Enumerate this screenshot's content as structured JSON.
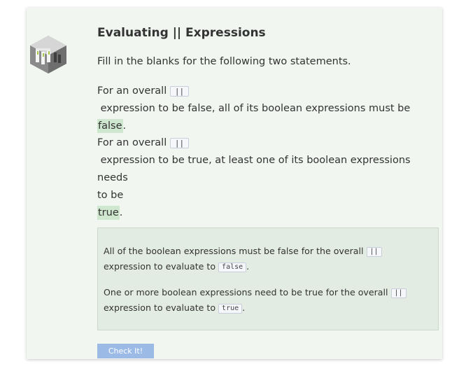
{
  "title": "Evaluating || Expressions",
  "instruction": "Fill in the blanks for the following two statements.",
  "statement1": {
    "prefix": "For an overall",
    "operator": "||",
    "text": "expression to be false, all of its boolean expressions must be",
    "answer": "false",
    "suffix": "."
  },
  "statement2": {
    "prefix": "For an overall",
    "operator": "||",
    "text_line1": "expression to be true, at least one of its boolean expressions needs",
    "text_line2": "to be",
    "answer": "true",
    "suffix": "."
  },
  "feedback": {
    "line1_text": "All of the boolean expressions must be false for the overall",
    "line1_operator": "||",
    "line1_cont": "expression to evaluate to",
    "line1_value": "false",
    "line2_text": "One or more boolean expressions need to be true for the overall",
    "line2_operator": "||",
    "line2_cont": "expression to evaluate to",
    "line2_value": "true"
  },
  "check_button_label": "Check It!",
  "colors": {
    "card_background": "#f1f6f1",
    "answer_highlight": "#cfe6cf",
    "feedback_background": "#e2ece2",
    "button": "#9bbae6"
  },
  "icons": {
    "logo": "boolean-circuit-logo-icon"
  }
}
